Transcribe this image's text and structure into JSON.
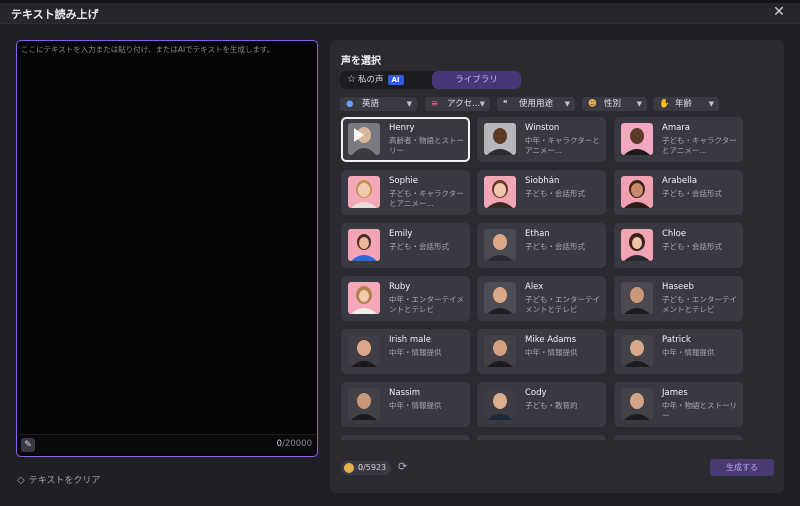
{
  "dialog": {
    "title": "テキスト読み上げ",
    "close_glyph": "✕"
  },
  "editor": {
    "placeholder": "ここにテキストを入力または貼り付け、またはAIでテキストを生成します。",
    "counter_current": "0",
    "counter_max": "/20000",
    "clear_label": "テキストをクリア"
  },
  "voice_panel": {
    "title": "声を選択",
    "tabs": [
      {
        "label": "私の声",
        "badge": "AI"
      },
      {
        "label": "ライブラリ",
        "active": true
      }
    ],
    "filters": [
      {
        "label": "英語",
        "icon": "globe-icon"
      },
      {
        "label": "アクセ...",
        "icon": "lips-icon"
      },
      {
        "label": "使用用途",
        "icon": "quote-icon"
      },
      {
        "label": "性別",
        "icon": "person-icon"
      },
      {
        "label": "年齢",
        "icon": "hand-icon"
      }
    ],
    "voices": [
      {
        "name": "Henry",
        "desc": "高齢者・物語とストーリー",
        "selected": true
      },
      {
        "name": "Winston",
        "desc": "中年・キャラクターとアニメー..."
      },
      {
        "name": "Amara",
        "desc": "子ども・キャラクターとアニメー..."
      },
      {
        "name": "Sophie",
        "desc": "子ども・キャラクターとアニメー..."
      },
      {
        "name": "Siobhán",
        "desc": "子ども・会話形式"
      },
      {
        "name": "Arabella",
        "desc": "子ども・会話形式"
      },
      {
        "name": "Emily",
        "desc": "子ども・会話形式"
      },
      {
        "name": "Ethan",
        "desc": "子ども・会話形式"
      },
      {
        "name": "Chloe",
        "desc": "子ども・会話形式"
      },
      {
        "name": "Ruby",
        "desc": "中年・エンターテイメントとテレビ"
      },
      {
        "name": "Alex",
        "desc": "子ども・エンターテイメントとテレビ"
      },
      {
        "name": "Haseeb",
        "desc": "子ども・エンターテイメントとテレビ"
      },
      {
        "name": "Irish male",
        "desc": "中年・情報提供"
      },
      {
        "name": "Mike Adams",
        "desc": "中年・情報提供"
      },
      {
        "name": "Patrick",
        "desc": "中年・情報提供"
      },
      {
        "name": "Nassim",
        "desc": "中年・情報提供"
      },
      {
        "name": "Cody",
        "desc": "子ども・教育的"
      },
      {
        "name": "James",
        "desc": "中年・物語とストーリー"
      }
    ],
    "credits_used": "0",
    "credits_total": "/5923",
    "generate_label": "生成する"
  },
  "colors": {
    "accent": "#8a5ee6",
    "tab_active_bg": "#4a3579",
    "card_bg": "#393941",
    "panel_bg": "#2a2a31",
    "coin": "#e6b04a"
  }
}
